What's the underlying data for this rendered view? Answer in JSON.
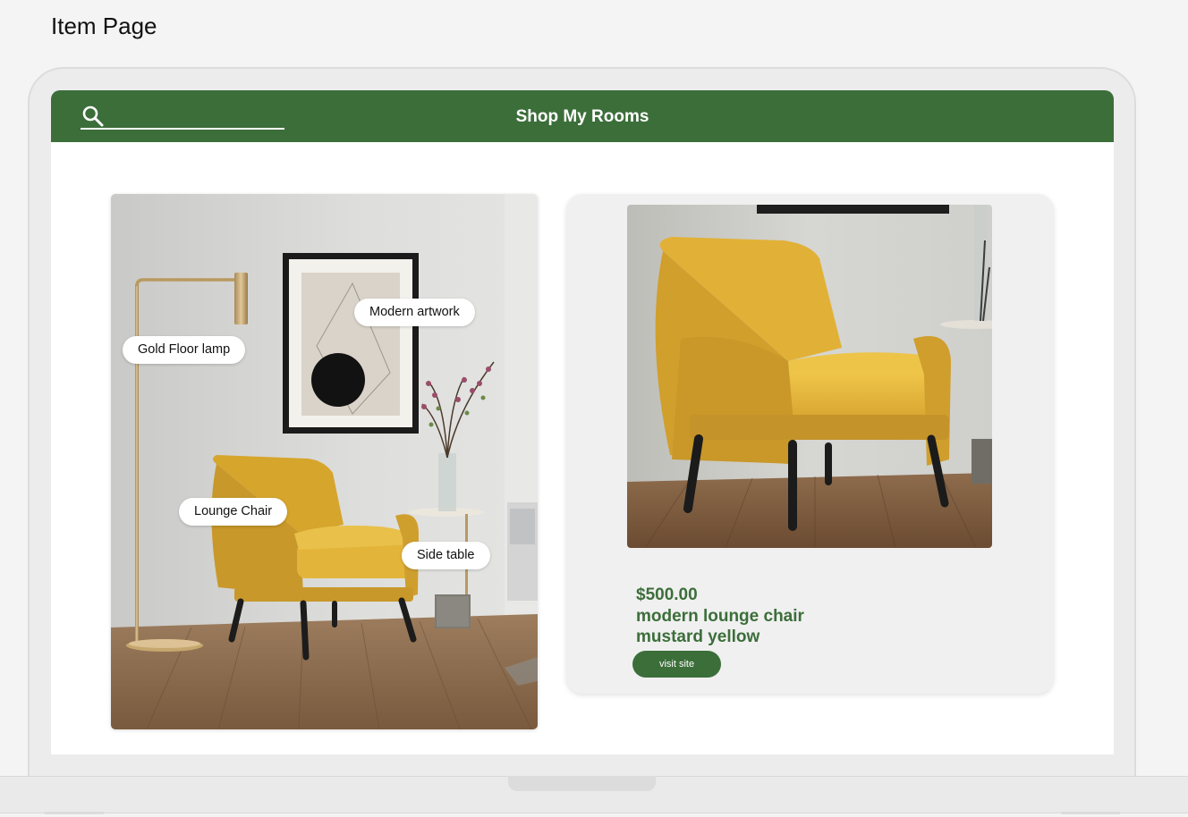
{
  "page": {
    "title": "Item Page"
  },
  "header": {
    "brand": "Shop My Rooms",
    "search": {
      "value": "",
      "placeholder": ""
    },
    "search_icon": "search-icon"
  },
  "room": {
    "tags": [
      {
        "label": "Modern artwork"
      },
      {
        "label": "Gold Floor lamp"
      },
      {
        "label": "Lounge Chair"
      },
      {
        "label": "Side table"
      }
    ]
  },
  "product": {
    "price": "$500.00",
    "name": "modern lounge chair mustard yellow",
    "button_label": "visit site"
  },
  "colors": {
    "brand_green": "#3c6e3a",
    "chair_yellow": "#e2b43a",
    "background": "#f4f4f4"
  }
}
